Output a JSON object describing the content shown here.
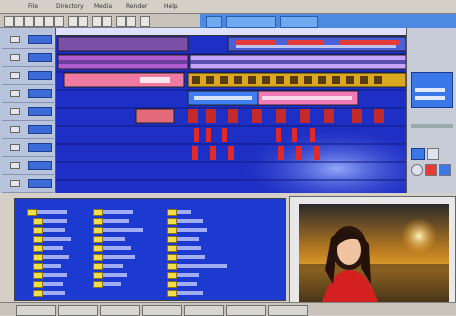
{
  "menu": {
    "items": [
      "File",
      "Directory",
      "Media",
      "Render",
      "Help"
    ]
  },
  "icons": [
    "new-icon",
    "open-icon",
    "save-icon",
    "cut-icon",
    "copy-icon",
    "paste-icon",
    "undo-icon",
    "redo-icon",
    "split-icon",
    "zoom-icon",
    "play-icon",
    "stop-icon"
  ],
  "colors": {
    "timeline_bg": "#1d2fc4",
    "video_clip": "#e8c23a",
    "audio_clip": "#e85a8a",
    "image_clip": "#e84040",
    "browser_bg": "#1c3ad0"
  },
  "tracks": [
    {
      "label": ""
    },
    {
      "label": ""
    },
    {
      "label": ""
    },
    {
      "label": ""
    },
    {
      "label": ""
    },
    {
      "label": ""
    },
    {
      "label": ""
    },
    {
      "label": ""
    },
    {
      "label": ""
    }
  ],
  "browser": {
    "tree_root": "",
    "columns": 3
  }
}
